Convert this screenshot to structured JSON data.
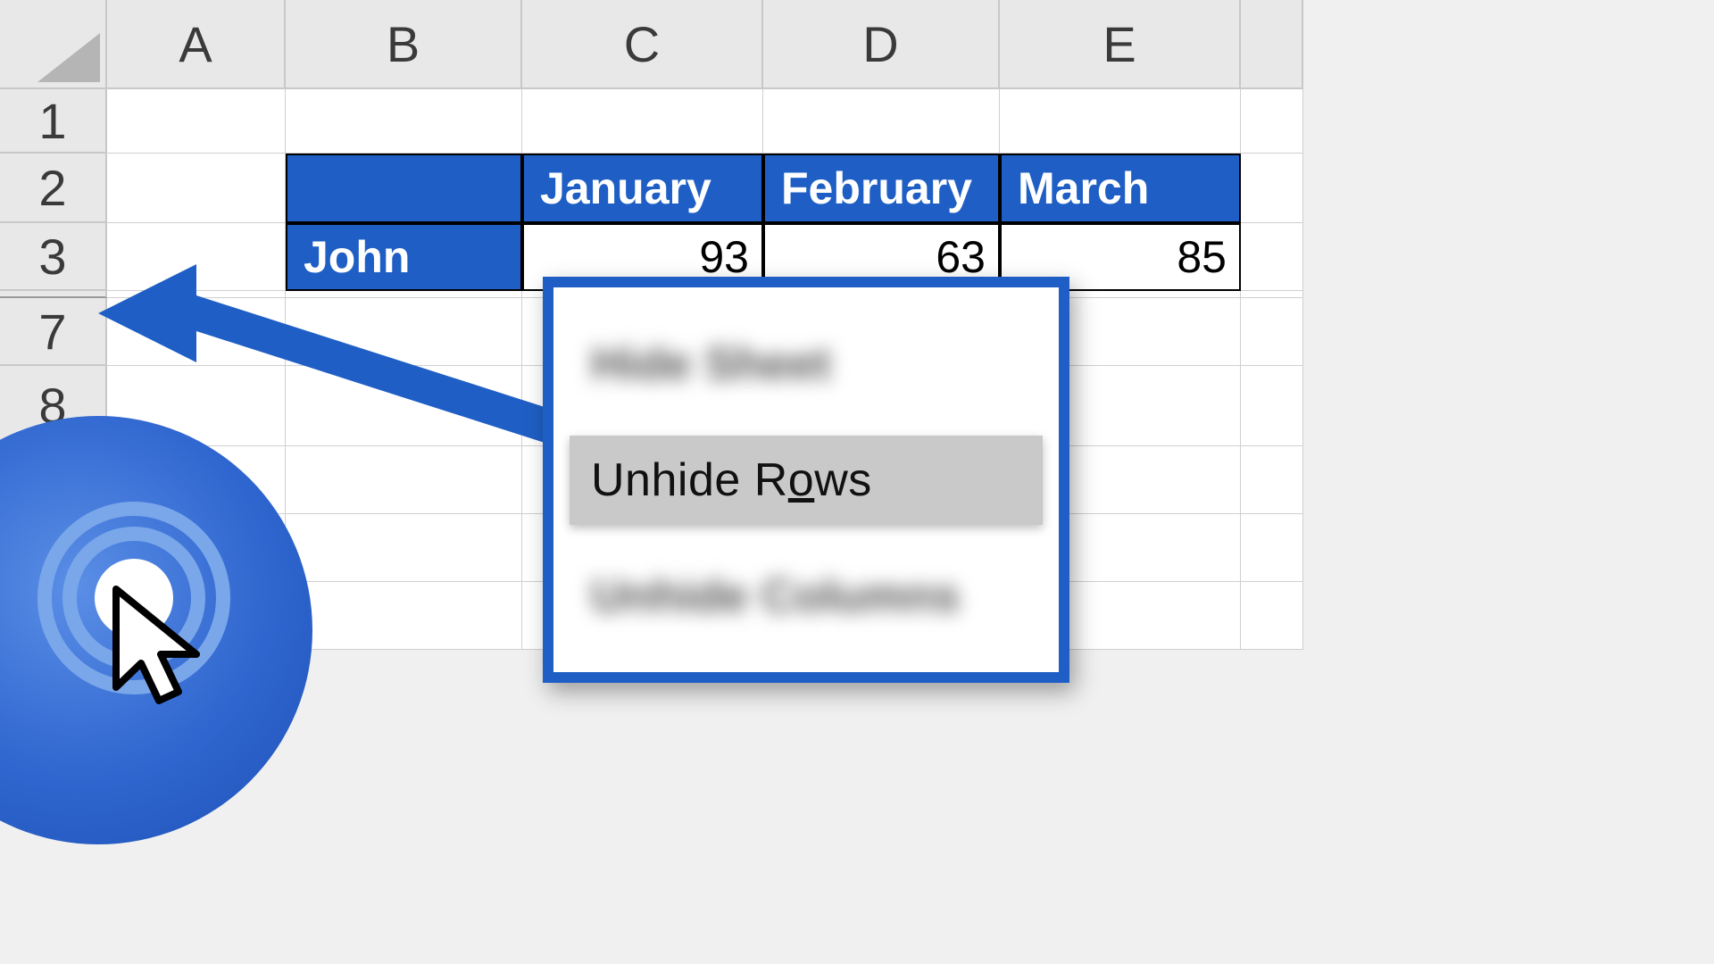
{
  "columns": [
    "A",
    "B",
    "C",
    "D",
    "E"
  ],
  "rows_visible": [
    "1",
    "2",
    "3",
    "7",
    "8"
  ],
  "table": {
    "corner_label": "",
    "months": [
      "January",
      "February",
      "March"
    ],
    "row": {
      "name": "John",
      "values": [
        "93",
        "63",
        "85"
      ]
    }
  },
  "menu": {
    "items": [
      {
        "label": "Hide Sheet",
        "blurred": true
      },
      {
        "label_pre": "Unhide R",
        "label_u": "o",
        "label_post": "ws",
        "blurred": false
      },
      {
        "label": "Unhide Columns",
        "blurred": true
      }
    ]
  }
}
